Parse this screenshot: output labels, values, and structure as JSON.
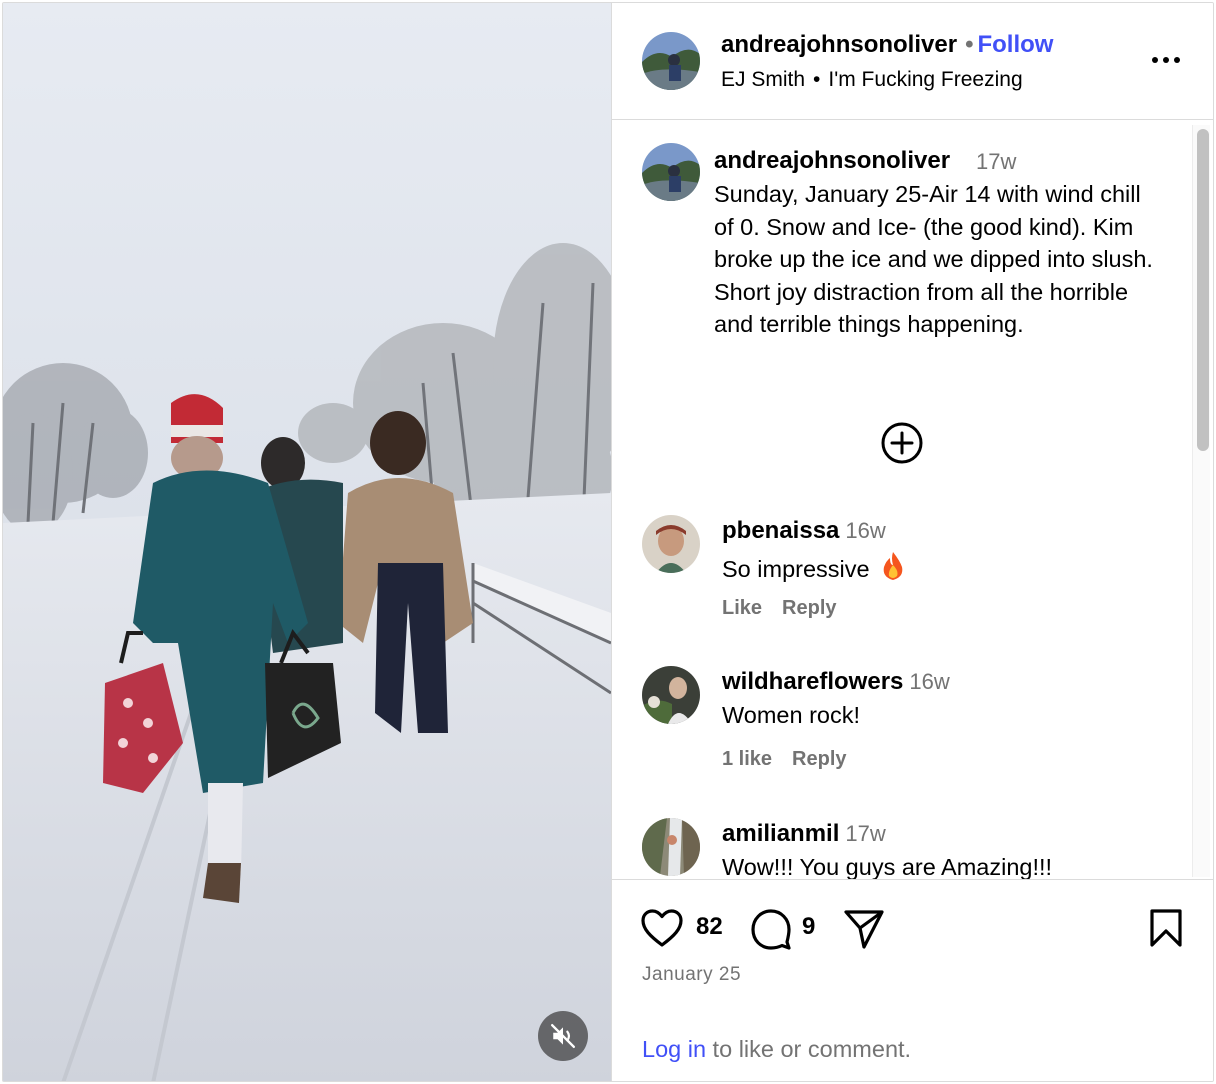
{
  "header": {
    "username": "andreajohnsonoliver",
    "dot": "•",
    "follow_label": "Follow",
    "subtitle_author": "EJ Smith",
    "subtitle_sep": "•",
    "subtitle_title": "I'm Fucking Freezing"
  },
  "caption": {
    "username": "andreajohnsonoliver",
    "time": "17w",
    "text": "Sunday, January 25-Air 14 with wind chill of 0. Snow and Ice- (the good kind). Kim broke up the ice and we dipped into slush. Short joy distraction from all the horrible and terrible things happening."
  },
  "comments": [
    {
      "username": "pbenaissa",
      "time": "16w",
      "text": "So impressive",
      "emoji": "fire-emoji",
      "like_label": "Like",
      "reply_label": "Reply"
    },
    {
      "username": "wildhareflowers",
      "time": "16w",
      "text": "Women rock!",
      "like_label": "1 like",
      "reply_label": "Reply"
    },
    {
      "username": "amilianmil",
      "time": "17w",
      "text": "Wow!!! You guys are Amazing!!!",
      "like_label": "",
      "reply_label": ""
    }
  ],
  "actions": {
    "likes": "82",
    "comments": "9"
  },
  "post_date": "January 25",
  "login": {
    "link": "Log in",
    "rest": " to like or comment."
  },
  "icons": {
    "more": "more-options-icon",
    "load_more": "plus-circle-icon",
    "like": "heart-icon",
    "comment": "comment-icon",
    "share": "share-icon",
    "save": "bookmark-icon",
    "mute": "muted-speaker-icon"
  },
  "colors": {
    "accent": "#4150f7",
    "secondary_text": "#737373",
    "border": "#dbdbdb"
  }
}
